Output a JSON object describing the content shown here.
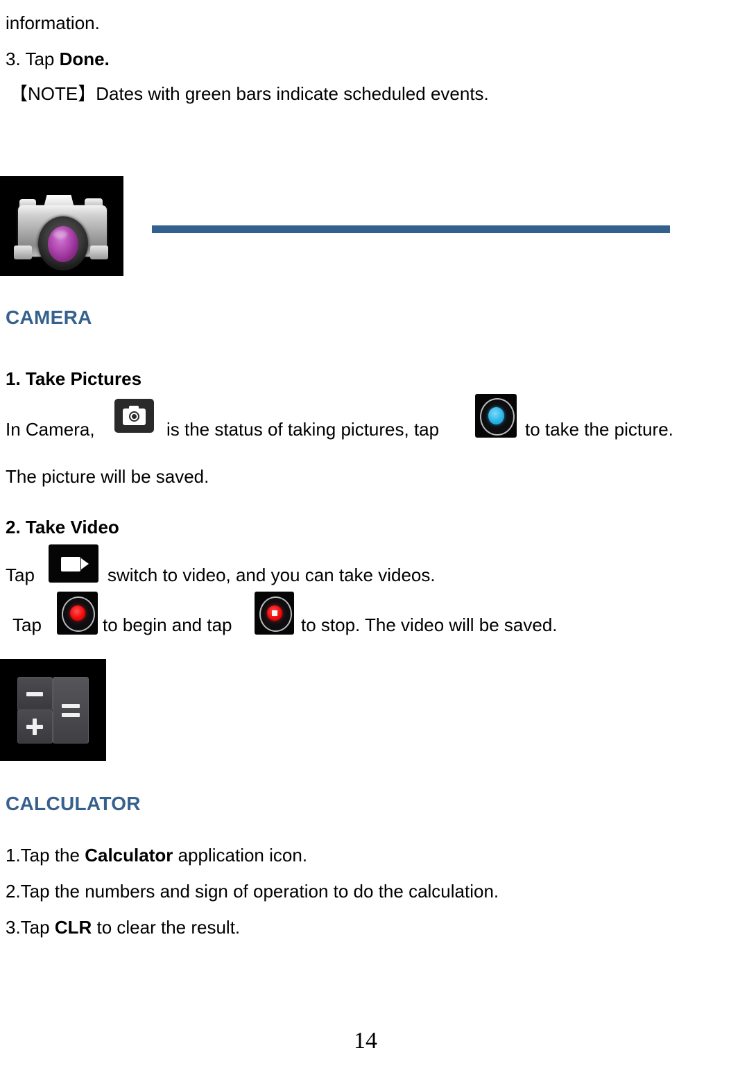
{
  "document": {
    "page_number": "14",
    "accent_color": "#33618F",
    "heading_color": "#36618E"
  },
  "top_section": {
    "line1": "information.",
    "line2_prefix": "3. Tap ",
    "line2_bold": "Done.",
    "note_line": "【NOTE】Dates with green bars indicate scheduled events."
  },
  "camera_section": {
    "app_icon_name": "camera-app-icon",
    "heading": "CAMERA",
    "sub1_heading": "1. Take Pictures",
    "sub1_part1": "In Camera,",
    "sub1_icon1": "photo-mode-icon",
    "sub1_part2": "is the status of taking pictures, tap",
    "sub1_icon2": "shutter-button-icon",
    "sub1_part3": "to take the picture.",
    "sub1_line2": "The picture will be saved.",
    "sub2_heading": "2. Take Video",
    "sub2_part1": "Tap",
    "sub2_icon1": "video-mode-icon",
    "sub2_part2": "switch to video, and you can take videos.",
    "sub2_line2_part1": "Tap",
    "sub2_line2_icon1": "record-start-icon",
    "sub2_line2_part2": "to begin and tap",
    "sub2_line2_icon2": "record-stop-icon",
    "sub2_line2_part3": "to stop. The video will be saved."
  },
  "calculator_section": {
    "app_icon_name": "calculator-app-icon",
    "heading": "CALCULATOR",
    "step1_prefix": "1.Tap the ",
    "step1_bold": "Calculator",
    "step1_suffix": " application icon.",
    "step2": "2.Tap the numbers and sign of operation to do the calculation.",
    "step3_prefix": "3.Tap ",
    "step3_bold": "CLR",
    "step3_suffix": " to clear the result."
  }
}
